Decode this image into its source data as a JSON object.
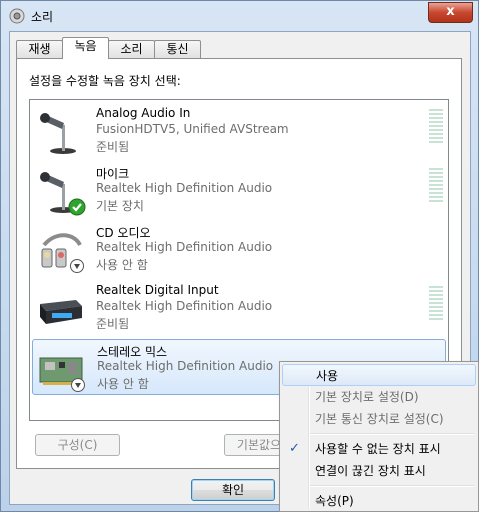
{
  "window": {
    "title": "소리",
    "close_label": "x"
  },
  "tabs": [
    {
      "label": "재생"
    },
    {
      "label": "녹음"
    },
    {
      "label": "소리"
    },
    {
      "label": "통신"
    }
  ],
  "instruction": "설정을 수정할 녹음 장치 선택:",
  "devices": [
    {
      "name": "Analog Audio In",
      "driver": "FusionHDTV5, Unified AVStream",
      "status": "준비됨"
    },
    {
      "name": "마이크",
      "driver": "Realtek High Definition Audio",
      "status": "기본 장치"
    },
    {
      "name": "CD 오디오",
      "driver": "Realtek High Definition Audio",
      "status": "사용 안 함"
    },
    {
      "name": "Realtek Digital Input",
      "driver": "Realtek High Definition Audio",
      "status": "준비됨"
    },
    {
      "name": "스테레오 믹스",
      "driver": "Realtek High Definition Audio",
      "status": "사용 안 함"
    }
  ],
  "buttons": {
    "configure": "구성(C)",
    "set_default": "기본값으",
    "ok": "확인"
  },
  "context_menu": {
    "items": [
      {
        "label": "사용"
      },
      {
        "label": "기본 장치로 설정(D)"
      },
      {
        "label": "기본 통신 장치로 설정(C)"
      },
      {
        "label": "사용할 수 없는 장치 표시"
      },
      {
        "label": "연결이 끊긴 장치 표시"
      },
      {
        "label": "속성(P)"
      }
    ]
  },
  "colors": {
    "accent": "#3399ff",
    "check_green": "#2fa52f",
    "selection": "#d6e8fb"
  }
}
